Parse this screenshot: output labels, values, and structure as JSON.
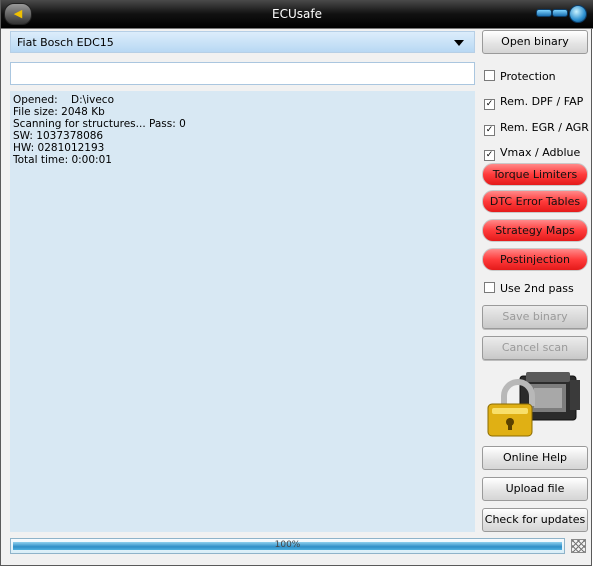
{
  "window": {
    "title": "ECUsafe"
  },
  "ecu_select": {
    "selected": "Fiat Bosch EDC15"
  },
  "status_field": {
    "value": ""
  },
  "log": {
    "lines": [
      "Opened:    D:\\iveco",
      "File size: 2048 Kb",
      "Scanning for structures... Pass: 0",
      "SW: 1037378086",
      "HW: 0281012193",
      "Total time: 0:00:01"
    ]
  },
  "buttons": {
    "open_binary": "Open binary",
    "save_binary": "Save binary",
    "cancel_scan": "Cancel scan",
    "online_help": "Online Help",
    "upload_file": "Upload file",
    "check_updates": "Check for updates"
  },
  "options": [
    {
      "label": "Protection",
      "checked": false
    },
    {
      "label": "Rem. DPF / FAP",
      "checked": true
    },
    {
      "label": "Rem. EGR / AGR",
      "checked": true
    },
    {
      "label": "Vmax / Adblue",
      "checked": true
    }
  ],
  "feature_buttons": [
    "Torque Limiters",
    "DTC Error Tables",
    "Strategy Maps",
    "Postinjection"
  ],
  "second_pass": {
    "label": "Use 2nd pass",
    "checked": false
  },
  "progress": {
    "text": "100%",
    "value": 1.0
  },
  "colors": {
    "accent_red": "#ff3b3b",
    "log_bg": "#d8e8f3"
  },
  "icons": {
    "titlebar_back": "back-arrow-icon",
    "titlebar_minimize": "minimize-icon",
    "titlebar_close": "orb-close-icon"
  }
}
